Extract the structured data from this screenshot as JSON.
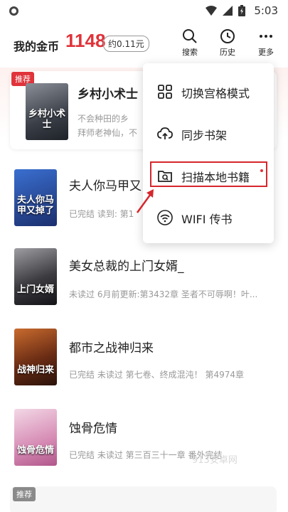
{
  "status_bar": {
    "time": "5:03"
  },
  "header": {
    "coins_label": "我的金币",
    "coins_value": "1148",
    "coins_approx": "约0.11元",
    "search_label": "搜索",
    "history_label": "历史",
    "more_label": "更多"
  },
  "recommended": {
    "tag": "推荐",
    "title": "乡村小术士",
    "cover_text": "乡村小术士",
    "desc_line1": "不会种田的乡",
    "desc_line2": "拜师老神仙，不"
  },
  "books": [
    {
      "title": "夫人你马甲又",
      "meta": "已完结 读到: 第1",
      "cover_text": "夫人你马甲又掉了"
    },
    {
      "title": "美女总裁的上门女婿_",
      "meta": "未读过 6月前更新:第3432章 圣者不可辱啊！叶...",
      "cover_text": "上门女婿"
    },
    {
      "title": "都市之战神归来",
      "meta": "已完结 未读过 第七卷、终成混沌！ 第4974章",
      "cover_text": "战神归来"
    },
    {
      "title": "蚀骨危情",
      "meta": "已完结 未读过 第三百三十一章 番外完结",
      "cover_text": "蚀骨危情"
    }
  ],
  "menu": {
    "items": [
      {
        "label": "切换宫格模式",
        "icon": "grid-icon"
      },
      {
        "label": "同步书架",
        "icon": "cloud-sync-icon"
      },
      {
        "label": "扫描本地书籍",
        "icon": "folder-scan-icon"
      },
      {
        "label": "WIFI 传书",
        "icon": "wifi-icon"
      }
    ]
  },
  "bottom": {
    "tag": "推荐"
  },
  "watermark": "913安卓网",
  "colors": {
    "accent": "#e0333a",
    "highlight_border": "#d6262c"
  }
}
